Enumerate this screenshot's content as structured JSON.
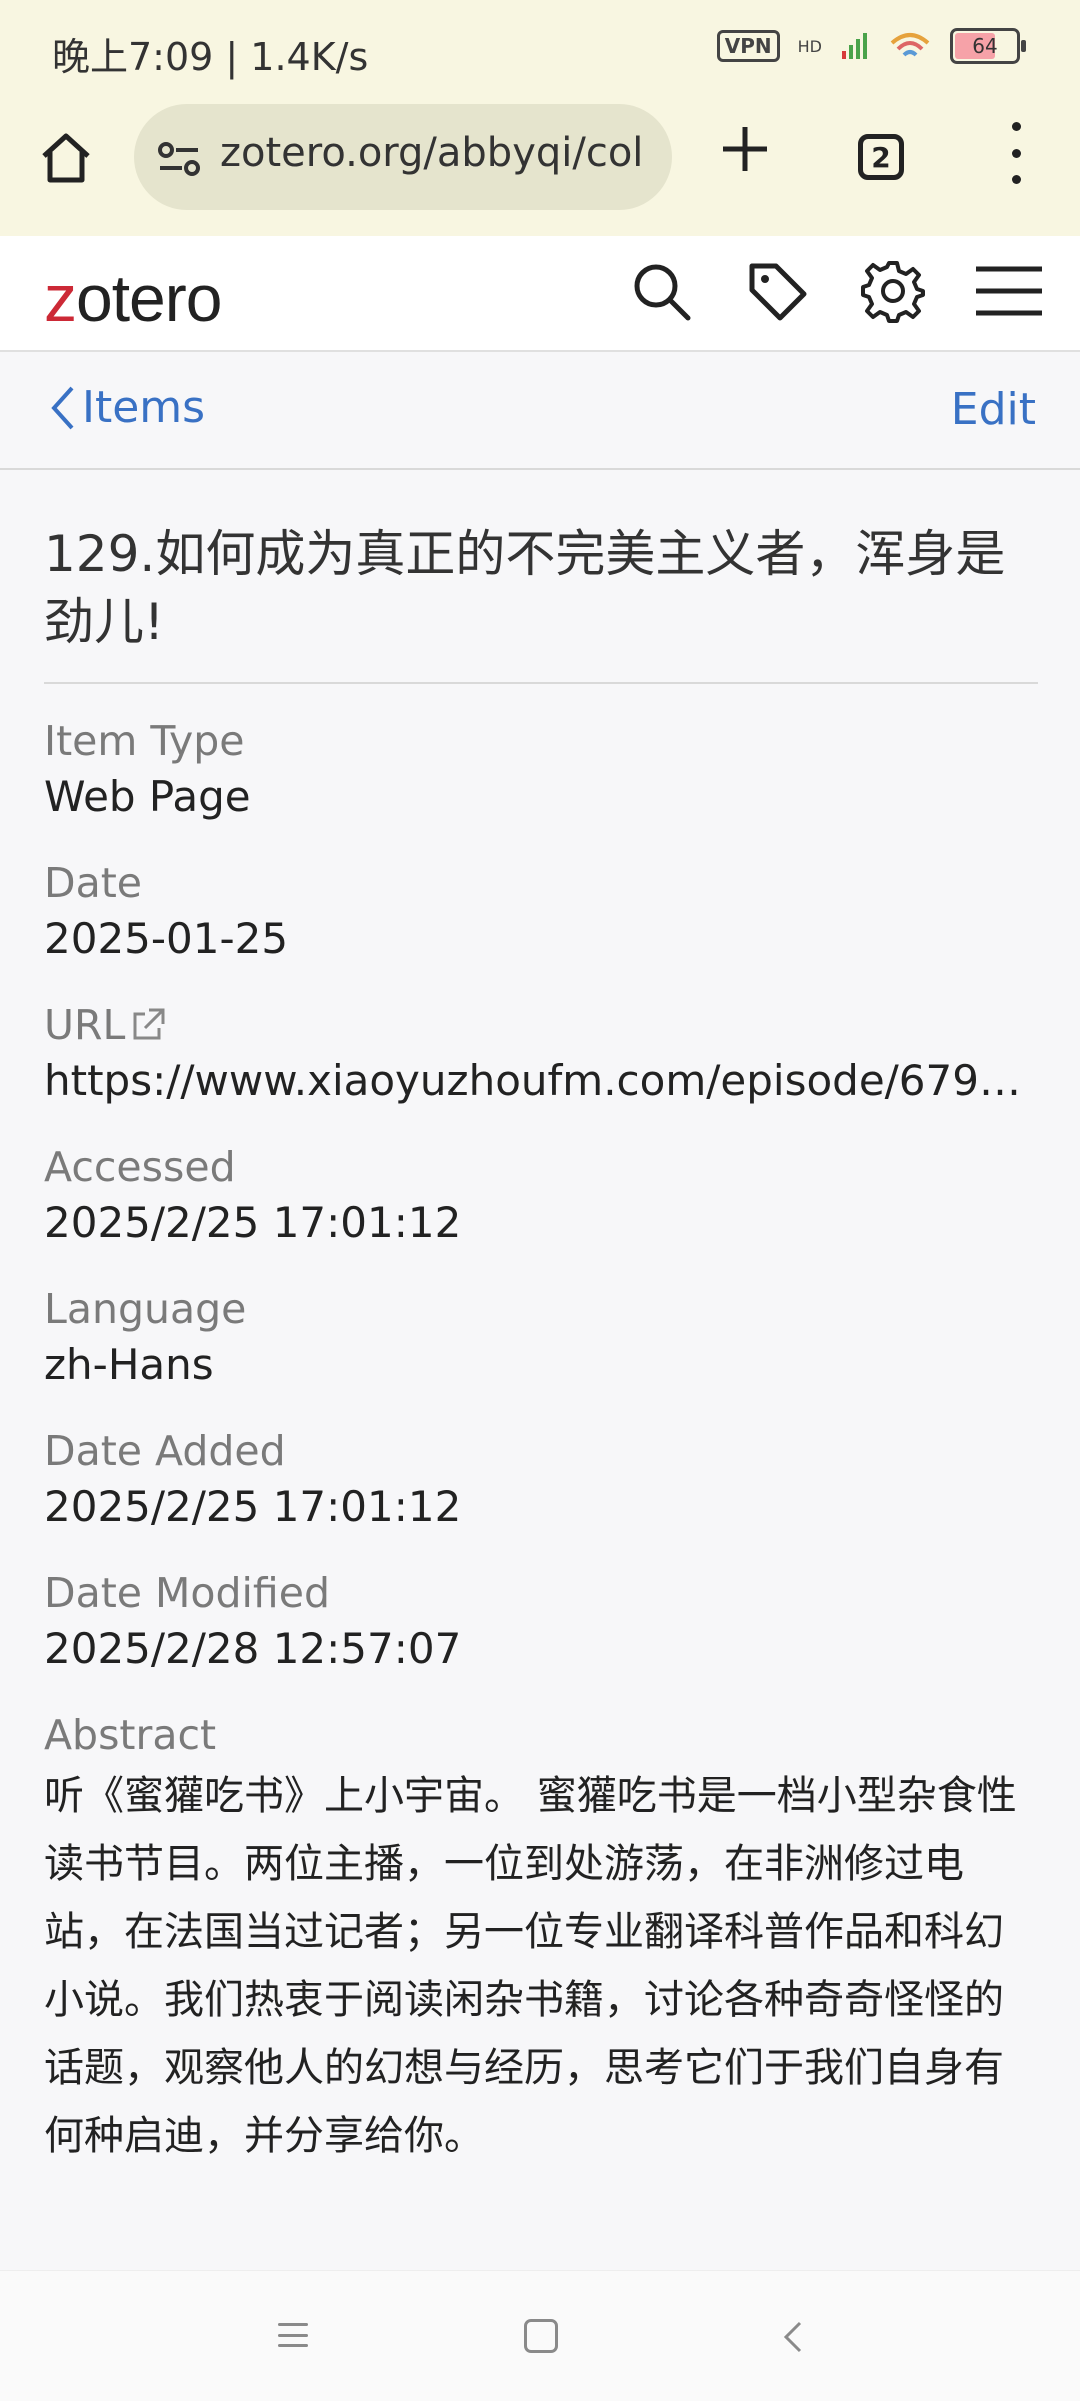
{
  "status_bar": {
    "time_speed": "晚上7:09 | 1.4K/s",
    "vpn": "VPN",
    "hd": "HD",
    "battery": "64"
  },
  "browser": {
    "url": "zotero.org/abbyqi/col",
    "tab_count": "2"
  },
  "zotero": {
    "logo_accent": "z",
    "logo_rest": "otero"
  },
  "nav": {
    "back_label": "Items",
    "edit_label": "Edit"
  },
  "item": {
    "title": "129.如何成为真正的不完美主义者，浑身是劲儿!",
    "fields": [
      {
        "label": "Item Type",
        "value": "Web Page"
      },
      {
        "label": "Date",
        "value": "2025-01-25"
      },
      {
        "label": "URL",
        "value": "https://www.xiaoyuzhoufm.com/episode/6794..."
      },
      {
        "label": "Accessed",
        "value": "2025/2/25 17:01:12"
      },
      {
        "label": "Language",
        "value": "zh-Hans"
      },
      {
        "label": "Date Added",
        "value": "2025/2/25 17:01:12"
      },
      {
        "label": "Date Modified",
        "value": "2025/2/28 12:57:07"
      },
      {
        "label": "Abstract",
        "value": "听《蜜獾吃书》上小宇宙。 蜜獾吃书是一档小型杂食性读书节目。两位主播，一位到处游荡，在非洲修过电站，在法国当过记者；另一位专业翻译科普作品和科幻小说。我们热衷于阅读闲杂书籍，讨论各种奇奇怪怪的话题，观察他人的幻想与经历，思考它们于我们自身有何种启迪，并分享给你。"
      }
    ]
  },
  "colors": {
    "chrome_bg": "#f8f6e1",
    "link_blue": "#3971c4",
    "logo_red": "#cc2936"
  }
}
